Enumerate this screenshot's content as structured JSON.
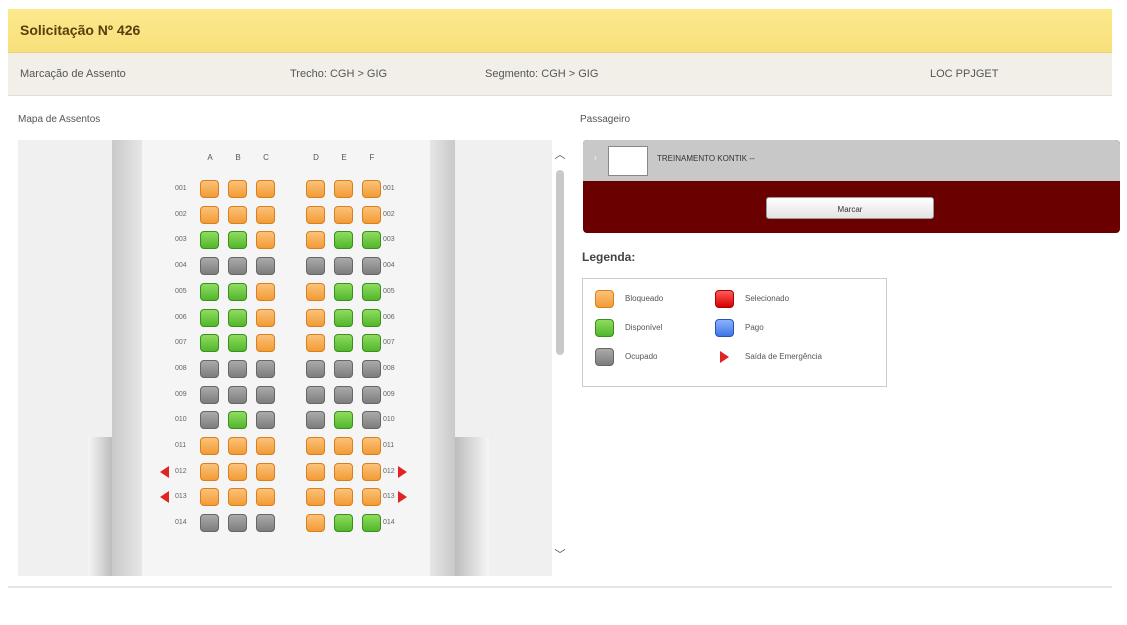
{
  "header": {
    "title": "Solicitação Nº 426"
  },
  "subheader": {
    "label": "Marcação de Assento",
    "trecho": "Trecho: CGH > GIG",
    "segmento": "Segmento: CGH > GIG",
    "loc": "LOC PPJGET"
  },
  "seat_map": {
    "title": "Mapa de Assentos",
    "columns_left": [
      "A",
      "B",
      "C"
    ],
    "columns_right": [
      "D",
      "E",
      "F"
    ],
    "rows": [
      {
        "number": "001",
        "seats": [
          "orange",
          "orange",
          "orange",
          "orange",
          "orange",
          "orange"
        ],
        "exit": false
      },
      {
        "number": "002",
        "seats": [
          "orange",
          "orange",
          "orange",
          "orange",
          "orange",
          "orange"
        ],
        "exit": false
      },
      {
        "number": "003",
        "seats": [
          "green",
          "green",
          "orange",
          "orange",
          "green",
          "green"
        ],
        "exit": false
      },
      {
        "number": "004",
        "seats": [
          "grey",
          "grey",
          "grey",
          "grey",
          "grey",
          "grey"
        ],
        "exit": false
      },
      {
        "number": "005",
        "seats": [
          "green",
          "green",
          "orange",
          "orange",
          "green",
          "green"
        ],
        "exit": false
      },
      {
        "number": "006",
        "seats": [
          "green",
          "green",
          "orange",
          "orange",
          "green",
          "green"
        ],
        "exit": false
      },
      {
        "number": "007",
        "seats": [
          "green",
          "green",
          "orange",
          "orange",
          "green",
          "green"
        ],
        "exit": false
      },
      {
        "number": "008",
        "seats": [
          "grey",
          "grey",
          "grey",
          "grey",
          "grey",
          "grey"
        ],
        "exit": false
      },
      {
        "number": "009",
        "seats": [
          "grey",
          "grey",
          "grey",
          "grey",
          "grey",
          "grey"
        ],
        "exit": false
      },
      {
        "number": "010",
        "seats": [
          "grey",
          "green",
          "grey",
          "grey",
          "green",
          "grey"
        ],
        "exit": false
      },
      {
        "number": "011",
        "seats": [
          "orange",
          "orange",
          "orange",
          "orange",
          "orange",
          "orange"
        ],
        "exit": false
      },
      {
        "number": "012",
        "seats": [
          "orange",
          "orange",
          "orange",
          "orange",
          "orange",
          "orange"
        ],
        "exit": true
      },
      {
        "number": "013",
        "seats": [
          "orange",
          "orange",
          "orange",
          "orange",
          "orange",
          "orange"
        ],
        "exit": true
      },
      {
        "number": "014",
        "seats": [
          "grey",
          "grey",
          "grey",
          "orange",
          "green",
          "green"
        ],
        "exit": false
      }
    ]
  },
  "passenger": {
    "title": "Passageiro",
    "toggle": "›",
    "name": "TREINAMENTO KONTIK  --",
    "button": "Marcar"
  },
  "legend": {
    "title": "Legenda:",
    "items": [
      {
        "label": "Bloqueado",
        "type": "orange"
      },
      {
        "label": "Disponível",
        "type": "green"
      },
      {
        "label": "Ocupado",
        "type": "grey"
      },
      {
        "label": "Selecionado",
        "type": "red"
      },
      {
        "label": "Pago",
        "type": "blue"
      },
      {
        "label": "Saída de Emergência",
        "type": "exit"
      }
    ]
  },
  "colors": {
    "title_bg": "#f9e384",
    "panel_dark": "#6b0000",
    "seat_orange": "#f29b35",
    "seat_green": "#52b62c",
    "seat_grey": "#7d7d7d",
    "seat_red": "#d80000",
    "seat_blue": "#3f74e6",
    "exit_arrow": "#e02424"
  }
}
